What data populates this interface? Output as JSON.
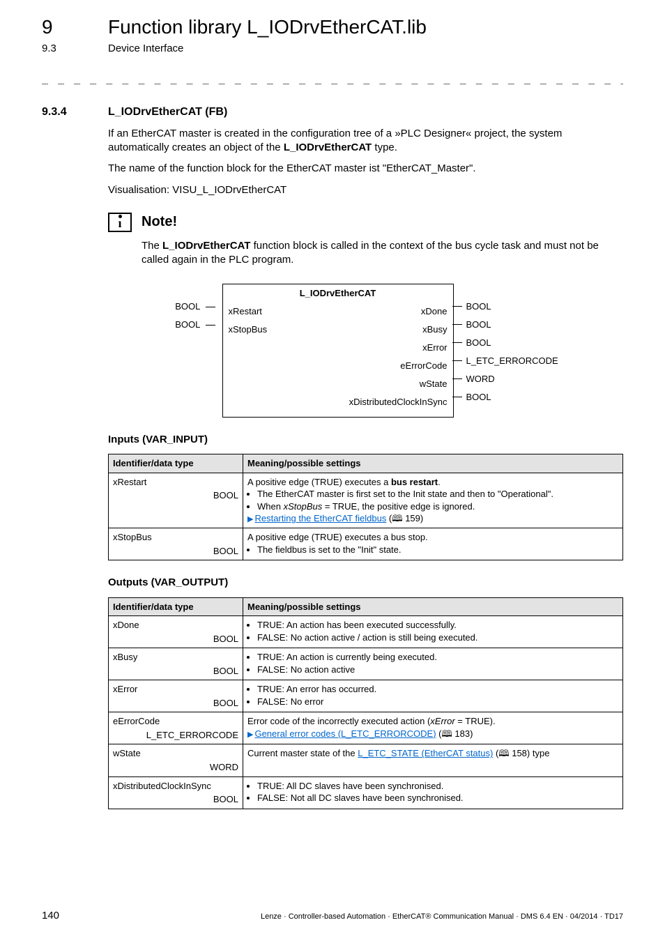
{
  "header": {
    "chapter_num": "9",
    "chapter_title": "Function library L_IODrvEtherCAT.lib",
    "section_num": "9.3",
    "section_title": "Device Interface",
    "dashes": "_ _ _ _ _ _ _ _ _ _ _ _ _ _ _ _ _ _ _ _ _ _ _ _ _ _ _ _ _ _ _ _ _ _ _ _ _ _ _ _ _ _ _ _ _ _ _ _ _ _ _ _ _ _ _ _ _ _ _ _ _ _ _ _"
  },
  "section": {
    "num": "9.3.4",
    "title": "L_IODrvEtherCAT (FB)",
    "p1a": "If an EtherCAT master is created in the configuration tree of a »PLC Designer« project, the system automatically creates an object of the ",
    "p1b": "L_IODrvEtherCAT",
    "p1c": " type.",
    "p2": "The name of the function block for the EtherCAT master ist \"EtherCAT_Master\".",
    "p3": "Visualisation: VISU_L_IODrvEtherCAT"
  },
  "note": {
    "label": "Note!",
    "body_a": "The ",
    "body_b": "L_IODrvEtherCAT",
    "body_c": " function block is called in the context of the bus cycle task and must not be called again in the PLC program."
  },
  "fb": {
    "title": "L_IODrvEtherCAT",
    "inputs": [
      {
        "type": "BOOL",
        "name": "xRestart"
      },
      {
        "type": "BOOL",
        "name": "xStopBus"
      }
    ],
    "outputs": [
      {
        "name": "xDone",
        "type": "BOOL"
      },
      {
        "name": "xBusy",
        "type": "BOOL"
      },
      {
        "name": "xError",
        "type": "BOOL"
      },
      {
        "name": "eErrorCode",
        "type": "L_ETC_ERRORCODE"
      },
      {
        "name": "wState",
        "type": "WORD"
      },
      {
        "name": "xDistributedClockInSync",
        "type": "BOOL"
      }
    ]
  },
  "inputs_table": {
    "heading": "Inputs (VAR_INPUT)",
    "h1": "Identifier/data type",
    "h2": "Meaning/possible settings",
    "rows": [
      {
        "id": "xRestart",
        "dtype": "BOOL",
        "line1a": "A positive edge (TRUE) executes a ",
        "line1b": "bus restart",
        "line1c": ".",
        "b1": "The EtherCAT master is first set to the Init state and then to \"Operational\".",
        "b2a": "When ",
        "b2b": "xStopBus",
        "b2c": " = TRUE, the positive edge is ignored.",
        "link": "Restarting the EtherCAT fieldbus",
        "linkref": " (🕮 159)"
      },
      {
        "id": "xStopBus",
        "dtype": "BOOL",
        "line1": "A positive edge (TRUE) executes a bus stop.",
        "b1": "The fieldbus is set to the \"Init\" state."
      }
    ]
  },
  "outputs_table": {
    "heading": "Outputs (VAR_OUTPUT)",
    "h1": "Identifier/data type",
    "h2": "Meaning/possible settings",
    "rows": [
      {
        "id": "xDone",
        "dtype": "BOOL",
        "b1": "TRUE: An action has been executed successfully.",
        "b2": "FALSE: No action active / action is still being executed."
      },
      {
        "id": "xBusy",
        "dtype": "BOOL",
        "b1": "TRUE: An action is currently being executed.",
        "b2": "FALSE: No action active"
      },
      {
        "id": "xError",
        "dtype": "BOOL",
        "b1": "TRUE: An error has occurred.",
        "b2": "FALSE: No error"
      },
      {
        "id": "eErrorCode",
        "dtype": "L_ETC_ERRORCODE",
        "line1a": "Error code of the incorrectly executed action (",
        "line1b": "xError",
        "line1c": " = TRUE).",
        "link": "General error codes (L_ETC_ERRORCODE)",
        "linkref": " (🕮 183)"
      },
      {
        "id": "wState",
        "dtype": "WORD",
        "line1a": "Current master state of the ",
        "link": "L_ETC_STATE (EtherCAT status)",
        "linkref": " (🕮 158)",
        "line1d": " type"
      },
      {
        "id": "xDistributedClockInSync",
        "dtype": "BOOL",
        "b1": "TRUE: All DC slaves have been synchronised.",
        "b2": "FALSE: Not all DC slaves have been synchronised."
      }
    ]
  },
  "footer": {
    "page": "140",
    "text": "Lenze · Controller-based Automation · EtherCAT® Communication Manual · DMS 6.4 EN · 04/2014 · TD17"
  }
}
